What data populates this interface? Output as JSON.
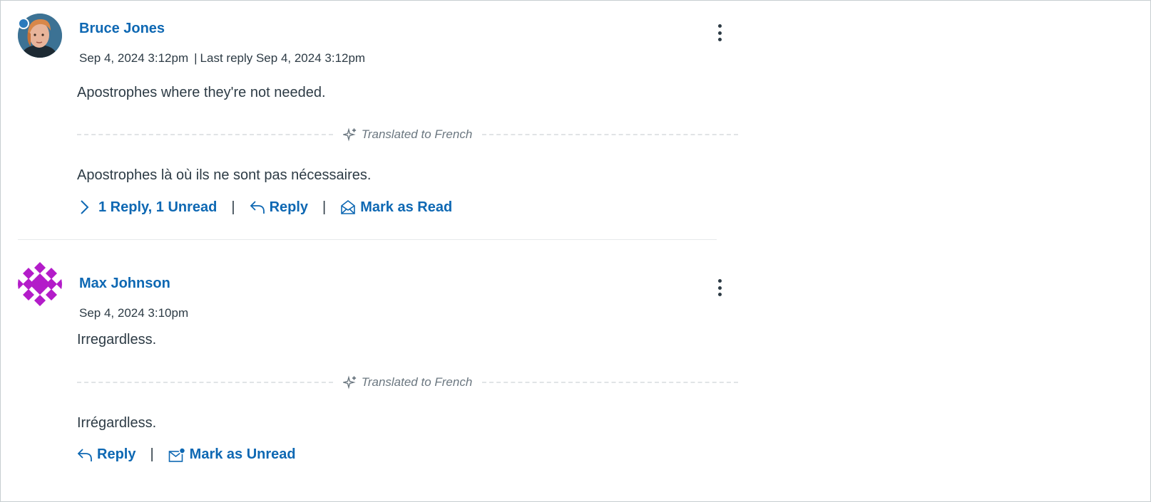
{
  "entries": [
    {
      "author": "Bruce Jones",
      "created": "Sep 4, 2024 3:12pm",
      "last_reply": "Last reply Sep 4, 2024 3:12pm",
      "original_message": "Apostrophes where they're not needed.",
      "translated_label": "Translated to French",
      "translated_message": "Apostrophes là où ils ne sont pas nécessaires.",
      "replies_label": "1 Reply, 1 Unread",
      "reply_label": "Reply",
      "mark_label": "Mark as Read",
      "unread": true
    },
    {
      "author": "Max Johnson",
      "created": "Sep 4, 2024 3:10pm",
      "original_message": "Irregardless.",
      "translated_label": "Translated to French",
      "translated_message": "Irrégardless.",
      "reply_label": "Reply",
      "mark_label": "Mark as Unread"
    }
  ],
  "separator": "|",
  "colors": {
    "link": "#0e68b3",
    "text": "#2d3b45",
    "unread_dot": "#2b7abc",
    "avatar_pattern": "#b31cc9"
  },
  "icons": {
    "kebab": "more-options-icon",
    "sparkle": "sparkle-icon",
    "chevron": "chevron-right-icon",
    "reply": "reply-arrow-icon",
    "mark_read": "open-envelope-icon",
    "mark_unread": "envelope-unread-icon"
  }
}
